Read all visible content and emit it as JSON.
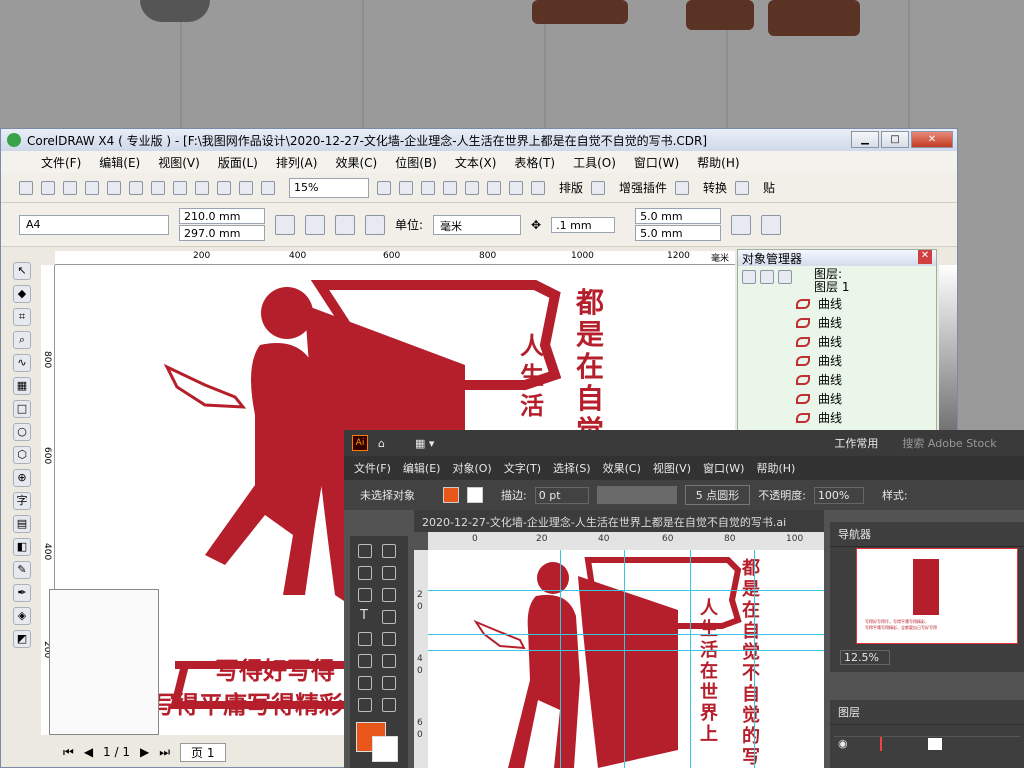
{
  "corel": {
    "title": "CorelDRAW X4 ( 专业版 ) - [F:\\我图网作品设计\\2020-12-27-文化墙-企业理念-人生活在世界上都是在自觉不自觉的写书.CDR]",
    "menu": [
      "文件(F)",
      "编辑(E)",
      "视图(V)",
      "版面(L)",
      "排列(A)",
      "效果(C)",
      "位图(B)",
      "文本(X)",
      "表格(T)",
      "工具(O)",
      "窗口(W)",
      "帮助(H)"
    ],
    "zoom": "15%",
    "toolbar_labels": [
      "排版",
      "增强插件",
      "转换",
      "贴"
    ],
    "page_size": "A4",
    "width": "210.0 mm",
    "height": "297.0 mm",
    "unit_label": "单位:",
    "unit": "毫米",
    "nudge": ".1 mm",
    "dup_x": "5.0 mm",
    "dup_y": "5.0 mm",
    "ruler_h": [
      "200",
      "400",
      "600",
      "800",
      "1000",
      "1200",
      "毫米"
    ],
    "ruler_v": [
      "800",
      "600",
      "400",
      "200"
    ],
    "page_nav": "1 / 1",
    "page_tab": "页 1",
    "text_tool": "字"
  },
  "object_manager": {
    "title": "对象管理器",
    "layer_line1": "图层:",
    "layer_line2": "图层 1",
    "items": [
      "曲线",
      "曲线",
      "曲线",
      "曲线",
      "曲线",
      "曲线",
      "曲线"
    ]
  },
  "artwork": {
    "right_column": "都是在自觉不自觉的写书",
    "left_column": "人生活在世界上",
    "banner1": "写得好写得坏",
    "banner2": "写得平庸写得精彩",
    "corel_right_visible": "都是在自觉",
    "corel_left_visible": "人生活",
    "corel_banner1_visible": "写得好写得",
    "corel_banner2_visible": "写得平庸写得精彩"
  },
  "ai": {
    "logo": "Ai",
    "workspace": "工作常用",
    "search_placeholder": "搜索 Adobe Stock",
    "menu": [
      "文件(F)",
      "编辑(E)",
      "对象(O)",
      "文字(T)",
      "选择(S)",
      "效果(C)",
      "视图(V)",
      "窗口(W)",
      "帮助(H)"
    ],
    "no_selection": "未选择对象",
    "stroke_label": "描边:",
    "stroke_value": "0 pt",
    "brush": "5 点圆形",
    "opacity_label": "不透明度:",
    "opacity": "100%",
    "style_label": "样式:",
    "doc_tab": "2020-12-27-文化墙-企业理念-人生活在世界上都是在自觉不自觉的写书.ai",
    "ruler": [
      "0",
      "20",
      "40",
      "60",
      "80",
      "100"
    ],
    "ruler_v": [
      "2",
      "0",
      "4",
      "0",
      "6",
      "0"
    ],
    "navigator": "导航器",
    "nav_zoom": "12.5%",
    "layers": "图层",
    "text_tool": "T",
    "nav_banner1": "写得好写得坏，写得平庸写得精彩，",
    "nav_banner2": "写得平庸写得精彩，全都要自己写好写得"
  },
  "colors": {
    "accent_red": "#b51f2b",
    "ai_orange": "#e8561a"
  }
}
